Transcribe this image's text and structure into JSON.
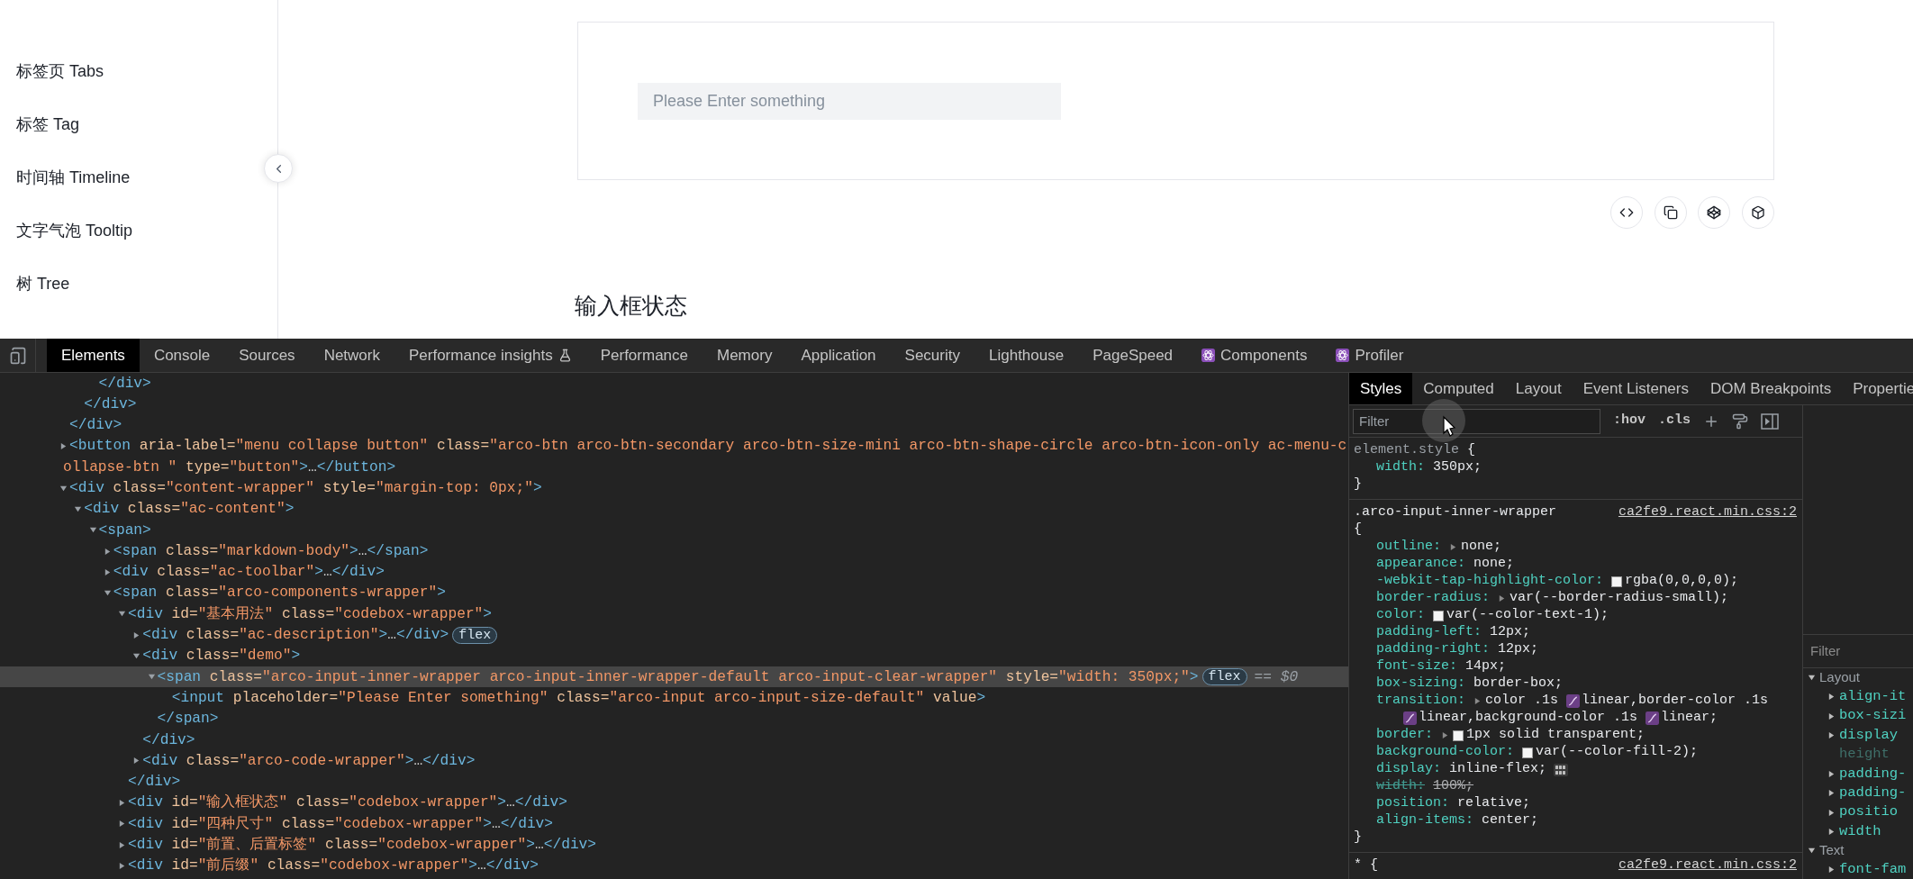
{
  "sidebar": {
    "items": [
      {
        "label": "标签页 Tabs",
        "selected": false
      },
      {
        "label": "标签 Tag",
        "selected": false
      },
      {
        "label": "时间轴 Timeline",
        "selected": false
      },
      {
        "label": "文字气泡 Tooltip",
        "selected": false
      },
      {
        "label": "树 Tree",
        "selected": false
      }
    ]
  },
  "demo": {
    "input": {
      "placeholder": "Please Enter something"
    }
  },
  "heading": "输入框状态",
  "devtools": {
    "tabs": [
      {
        "label": "Elements",
        "selected": true,
        "kind": "plain"
      },
      {
        "label": "Console",
        "selected": false,
        "kind": "plain"
      },
      {
        "label": "Sources",
        "selected": false,
        "kind": "plain"
      },
      {
        "label": "Network",
        "selected": false,
        "kind": "plain"
      },
      {
        "label": "Performance insights",
        "selected": false,
        "kind": "experiment"
      },
      {
        "label": "Performance",
        "selected": false,
        "kind": "plain"
      },
      {
        "label": "Memory",
        "selected": false,
        "kind": "plain"
      },
      {
        "label": "Application",
        "selected": false,
        "kind": "plain"
      },
      {
        "label": "Security",
        "selected": false,
        "kind": "plain"
      },
      {
        "label": "Lighthouse",
        "selected": false,
        "kind": "plain"
      },
      {
        "label": "PageSpeed",
        "selected": false,
        "kind": "plain"
      },
      {
        "label": "Components",
        "selected": false,
        "kind": "extension"
      },
      {
        "label": "Profiler",
        "selected": false,
        "kind": "extension"
      }
    ],
    "tree": [
      {
        "close": "</div>",
        "children": [
          {
            "close": "</div>",
            "children": [
              {
                "close": "</div>"
              }
            ]
          }
        ]
      },
      {
        "text": "<button aria-label=\"menu collapse button\" class=\"arco-btn arco-btn-secondary arco-btn-size-mini arco-btn-shape-circle arco-btn-icon-only ac-menu-c",
        "continuation": "ollapse-btn \" type=\"button\">…</button>",
        "expanded": false,
        "selected": false
      },
      {
        "text": "<div class=\"content-wrapper\" style=\"margin-top: 0px;\">",
        "expanded": true,
        "selected": false,
        "children": [
          {
            "text": "<div class=\"ac-content\">",
            "expanded": true,
            "selected": false,
            "children": [
              {
                "text": "<span>",
                "expanded": true,
                "selected": false,
                "children": [
                  {
                    "text": "<span class=\"markdown-body\">…</span>",
                    "expanded": false,
                    "selected": false
                  },
                  {
                    "text": "<div class=\"ac-toolbar\">…</div>",
                    "expanded": false,
                    "selected": false
                  },
                  {
                    "text": "<span class=\"arco-components-wrapper\">",
                    "expanded": true,
                    "selected": false,
                    "children": [
                      {
                        "text": "<div id=\"基本用法\" class=\"codebox-wrapper\">",
                        "expanded": true,
                        "selected": false,
                        "children": [
                          {
                            "text": "<div class=\"ac-description\">…</div>",
                            "expanded": false,
                            "selected": false,
                            "badges": [
                              "flex"
                            ]
                          },
                          {
                            "text": "<div class=\"demo\">",
                            "expanded": true,
                            "selected": false,
                            "children": [
                              {
                                "text": "<span class=\"arco-input-inner-wrapper arco-input-inner-wrapper-default arco-input-clear-wrapper\" style=\"width: 350px;\">",
                                "expanded": true,
                                "selected": true,
                                "badges": [
                                  "flex"
                                ],
                                "marker": "== $0",
                                "children": [
                                  {
                                    "text": "<input placeholder=\"Please Enter something\" class=\"arco-input arco-input-size-default\" value>",
                                    "selected": false
                                  }
                                ],
                                "close": "</span>"
                              }
                            ],
                            "close": "</div>"
                          },
                          {
                            "text": "<div class=\"arco-code-wrapper\">…</div>",
                            "expanded": false,
                            "selected": false
                          }
                        ],
                        "close": "</div>"
                      },
                      {
                        "text": "<div id=\"输入框状态\" class=\"codebox-wrapper\">…</div>",
                        "expanded": false,
                        "selected": false
                      },
                      {
                        "text": "<div id=\"四种尺寸\" class=\"codebox-wrapper\">…</div>",
                        "expanded": false,
                        "selected": false
                      },
                      {
                        "text": "<div id=\"前置、后置标签\" class=\"codebox-wrapper\">…</div>",
                        "expanded": false,
                        "selected": false
                      },
                      {
                        "text": "<div id=\"前后缀\" class=\"codebox-wrapper\">…</div>",
                        "expanded": false,
                        "selected": false
                      }
                    ]
                  }
                ]
              }
            ]
          }
        ]
      }
    ],
    "side_tabs": [
      {
        "label": "Styles",
        "selected": true
      },
      {
        "label": "Computed",
        "selected": false
      },
      {
        "label": "Layout",
        "selected": false
      },
      {
        "label": "Event Listeners",
        "selected": false
      },
      {
        "label": "DOM Breakpoints",
        "selected": false
      },
      {
        "label": "Propertie",
        "selected": false
      }
    ],
    "styles": {
      "filter": {
        "placeholder": "Filter"
      },
      "toggles": [
        ":hov",
        ".cls"
      ],
      "rules": [
        {
          "selector": "element.style",
          "inline": true,
          "brace": "{",
          "brace_own_line": false,
          "end": "}",
          "properties": [
            {
              "name": "width:",
              "value": "350px;",
              "expandable": false,
              "struck": false
            }
          ]
        },
        {
          "selector": ".arco-input-inner-wrapper",
          "inline": false,
          "source": "ca2fe9.react.min.css:2",
          "brace": "{",
          "brace_own_line": true,
          "end": "}",
          "properties": [
            {
              "name": "outline:",
              "value": "none;",
              "expandable": true,
              "struck": false
            },
            {
              "name": "appearance:",
              "value": "none;",
              "expandable": false,
              "struck": false
            },
            {
              "name": "-webkit-tap-highlight-color:",
              "value": "rgba(0,0,0,0);",
              "expandable": false,
              "struck": false,
              "swatch": true
            },
            {
              "name": "border-radius:",
              "value": "var(--border-radius-small);",
              "expandable": true,
              "struck": false
            },
            {
              "name": "color:",
              "value": "var(--color-text-1);",
              "expandable": false,
              "struck": false,
              "swatch": true
            },
            {
              "name": "padding-left:",
              "value": "12px;",
              "expandable": false,
              "struck": false
            },
            {
              "name": "padding-right:",
              "value": "12px;",
              "expandable": false,
              "struck": false
            },
            {
              "name": "font-size:",
              "value": "14px;",
              "expandable": false,
              "struck": false
            },
            {
              "name": "box-sizing:",
              "value": "border-box;",
              "expandable": false,
              "struck": false
            },
            {
              "name": "transition:",
              "expandable": true,
              "struck": false,
              "parts": [
                {
                  "kind": "text",
                  "text": "color .1s "
                },
                {
                  "kind": "easing"
                },
                {
                  "kind": "text",
                  "text": "linear,border-color .1s"
                },
                {
                  "kind": "break"
                },
                {
                  "kind": "easing"
                },
                {
                  "kind": "text",
                  "text": "linear,background-color .1s "
                },
                {
                  "kind": "easing"
                },
                {
                  "kind": "text",
                  "text": "linear;"
                }
              ]
            },
            {
              "name": "border:",
              "value": "1px solid transparent;",
              "expandable": true,
              "struck": false,
              "swatch": true
            },
            {
              "name": "background-color:",
              "value": "var(--color-fill-2);",
              "expandable": false,
              "struck": false,
              "swatch": true
            },
            {
              "name": "display:",
              "value": "inline-flex;",
              "expandable": false,
              "struck": false,
              "editor": true
            },
            {
              "name": "width:",
              "value": "100%;",
              "expandable": false,
              "struck": true
            },
            {
              "name": "position:",
              "value": "relative;",
              "expandable": false,
              "struck": false
            },
            {
              "name": "align-items:",
              "value": "center;",
              "expandable": false,
              "struck": false
            }
          ]
        },
        {
          "selector": "*",
          "inline": false,
          "source": "ca2fe9.react.min.css:2",
          "brace": "{",
          "brace_own_line": false
        }
      ]
    },
    "computed": {
      "filter": {
        "placeholder": "Filter"
      },
      "groups": [
        {
          "title": "Layout",
          "expanded": true,
          "items": [
            {
              "name": "align-it",
              "expandable": true
            },
            {
              "name": "box-sizi",
              "expandable": true
            },
            {
              "name": "display",
              "expandable": true
            },
            {
              "name": "height",
              "expandable": false
            },
            {
              "name": "padding-",
              "expandable": true
            },
            {
              "name": "padding-",
              "expandable": true
            },
            {
              "name": "positio",
              "expandable": true
            },
            {
              "name": "width",
              "expandable": true
            }
          ]
        },
        {
          "title": "Text",
          "expanded": true,
          "items": [
            {
              "name": "font-fam",
              "expandable": true
            }
          ]
        }
      ]
    }
  }
}
